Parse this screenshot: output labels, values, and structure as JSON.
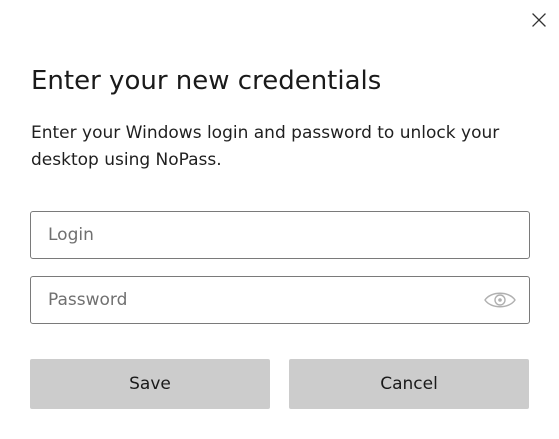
{
  "dialog": {
    "close_icon": "close-icon",
    "title": "Enter your new credentials",
    "description": "Enter your Windows login and password to unlock your desktop using NoPass."
  },
  "form": {
    "login": {
      "placeholder": "Login",
      "value": ""
    },
    "password": {
      "placeholder": "Password",
      "value": "",
      "reveal_icon": "eye-icon"
    }
  },
  "buttons": {
    "save_label": "Save",
    "cancel_label": "Cancel"
  },
  "colors": {
    "button_background": "#cccccc",
    "field_border": "#7a7a7a",
    "placeholder_text": "#707070",
    "background": "#ffffff"
  }
}
